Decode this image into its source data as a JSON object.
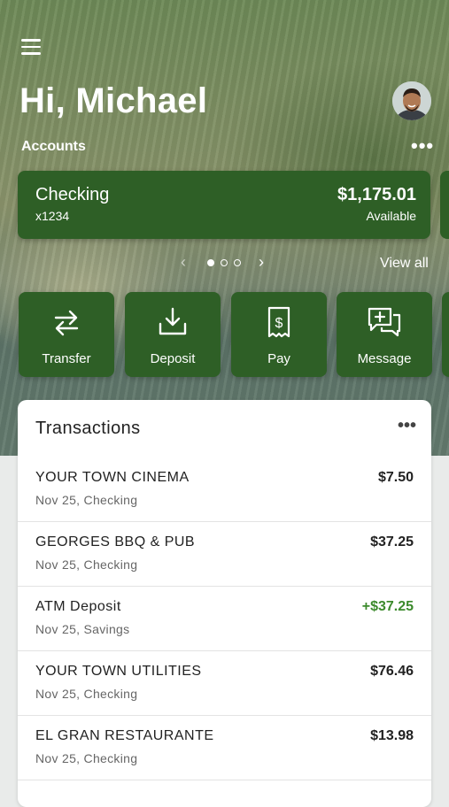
{
  "header": {
    "greeting": "Hi, Michael",
    "accounts_label": "Accounts"
  },
  "account_card": {
    "name": "Checking",
    "number": "x1234",
    "balance": "$1,175.01",
    "balance_label": "Available"
  },
  "pager": {
    "view_all": "View all",
    "total_pages": 3,
    "active_page": 1
  },
  "actions": [
    {
      "label": "Transfer",
      "icon": "transfer-icon"
    },
    {
      "label": "Deposit",
      "icon": "deposit-icon"
    },
    {
      "label": "Pay",
      "icon": "bill-icon"
    },
    {
      "label": "Message",
      "icon": "message-icon"
    }
  ],
  "transactions": {
    "title": "Transactions",
    "items": [
      {
        "merchant": "YOUR TOWN CINEMA",
        "meta": "Nov 25, Checking",
        "amount": "$7.50"
      },
      {
        "merchant": "GEORGES BBQ & PUB",
        "meta": "Nov 25, Checking",
        "amount": "$37.25"
      },
      {
        "merchant": "ATM Deposit",
        "meta": "Nov 25, Savings",
        "amount": "+$37.25"
      },
      {
        "merchant": "YOUR TOWN UTILITIES",
        "meta": "Nov 25, Checking",
        "amount": "$76.46"
      },
      {
        "merchant": "EL GRAN RESTAURANTE",
        "meta": "Nov 25, Checking",
        "amount": "$13.98"
      }
    ]
  },
  "colors": {
    "brand_green": "#2e5f26",
    "deposit_positive": "#3c8a2c"
  }
}
